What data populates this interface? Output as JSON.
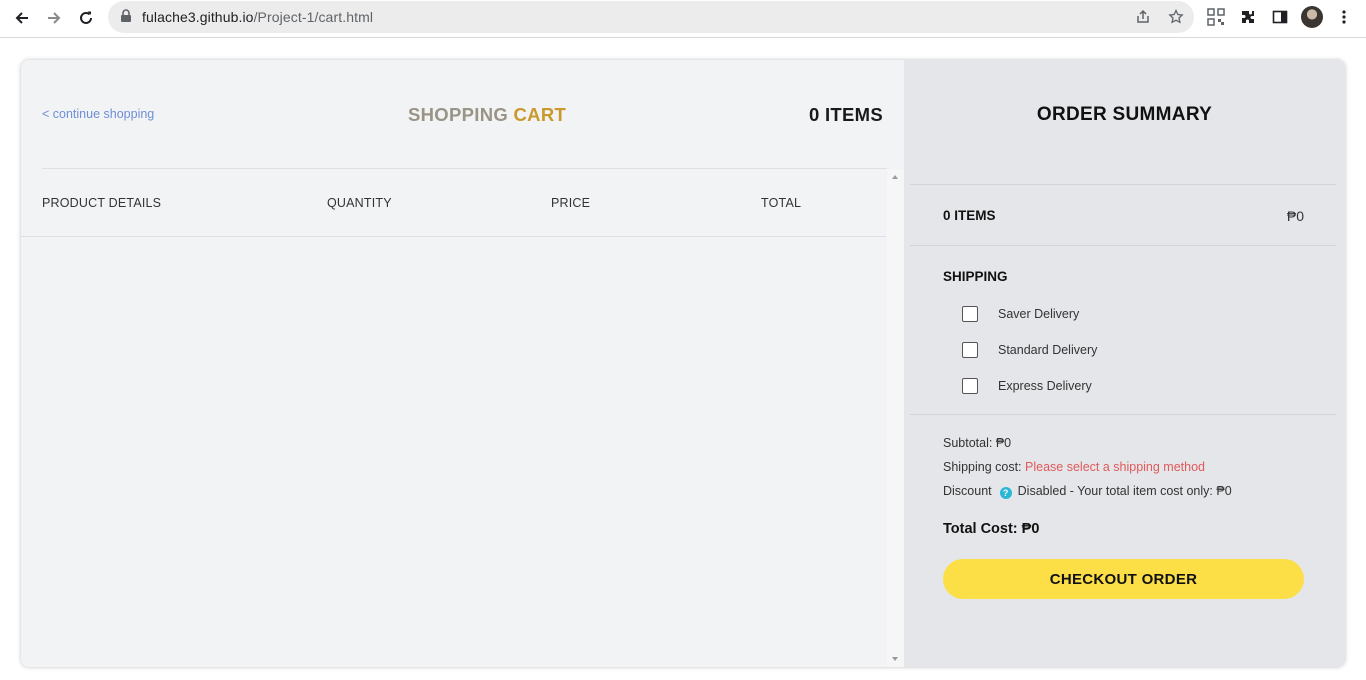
{
  "browser": {
    "url_host": "fulache3.github.io",
    "url_path": "/Project-1/cart.html"
  },
  "cart": {
    "continue_link": "< continue shopping",
    "title_word1": "SHOPPING",
    "title_word2": "CART",
    "items_count": "0 ITEMS",
    "columns": [
      "PRODUCT DETAILS",
      "QUANTITY",
      "PRICE",
      "TOTAL"
    ]
  },
  "summary": {
    "title": "ORDER SUMMARY",
    "items_label": "0 ITEMS",
    "items_amount": "₱0",
    "shipping_label": "SHIPPING",
    "shipping_options": [
      "Saver Delivery",
      "Standard Delivery",
      "Express Delivery"
    ],
    "subtotal": "Subtotal: ₱0",
    "shipping_cost_label": "Shipping cost:",
    "shipping_cost_value": "Please select a shipping method",
    "discount_label": "Discount",
    "discount_value": "Disabled - Your total item cost only: ₱0",
    "total": "Total Cost: ₱0",
    "checkout_label": "CHECKOUT ORDER"
  },
  "colors": {
    "accent_yellow": "#fcdf46",
    "title_gold": "#c9992b",
    "link_blue": "#6e8fd6",
    "warning_red": "#e05a5a",
    "help_cyan": "#2ab7d6"
  },
  "icons": [
    "back-icon",
    "forward-icon",
    "reload-icon",
    "lock-icon",
    "share-icon",
    "star-icon",
    "qr-icon",
    "extensions-icon",
    "side-panel-icon",
    "avatar",
    "more-icon",
    "help-icon"
  ]
}
